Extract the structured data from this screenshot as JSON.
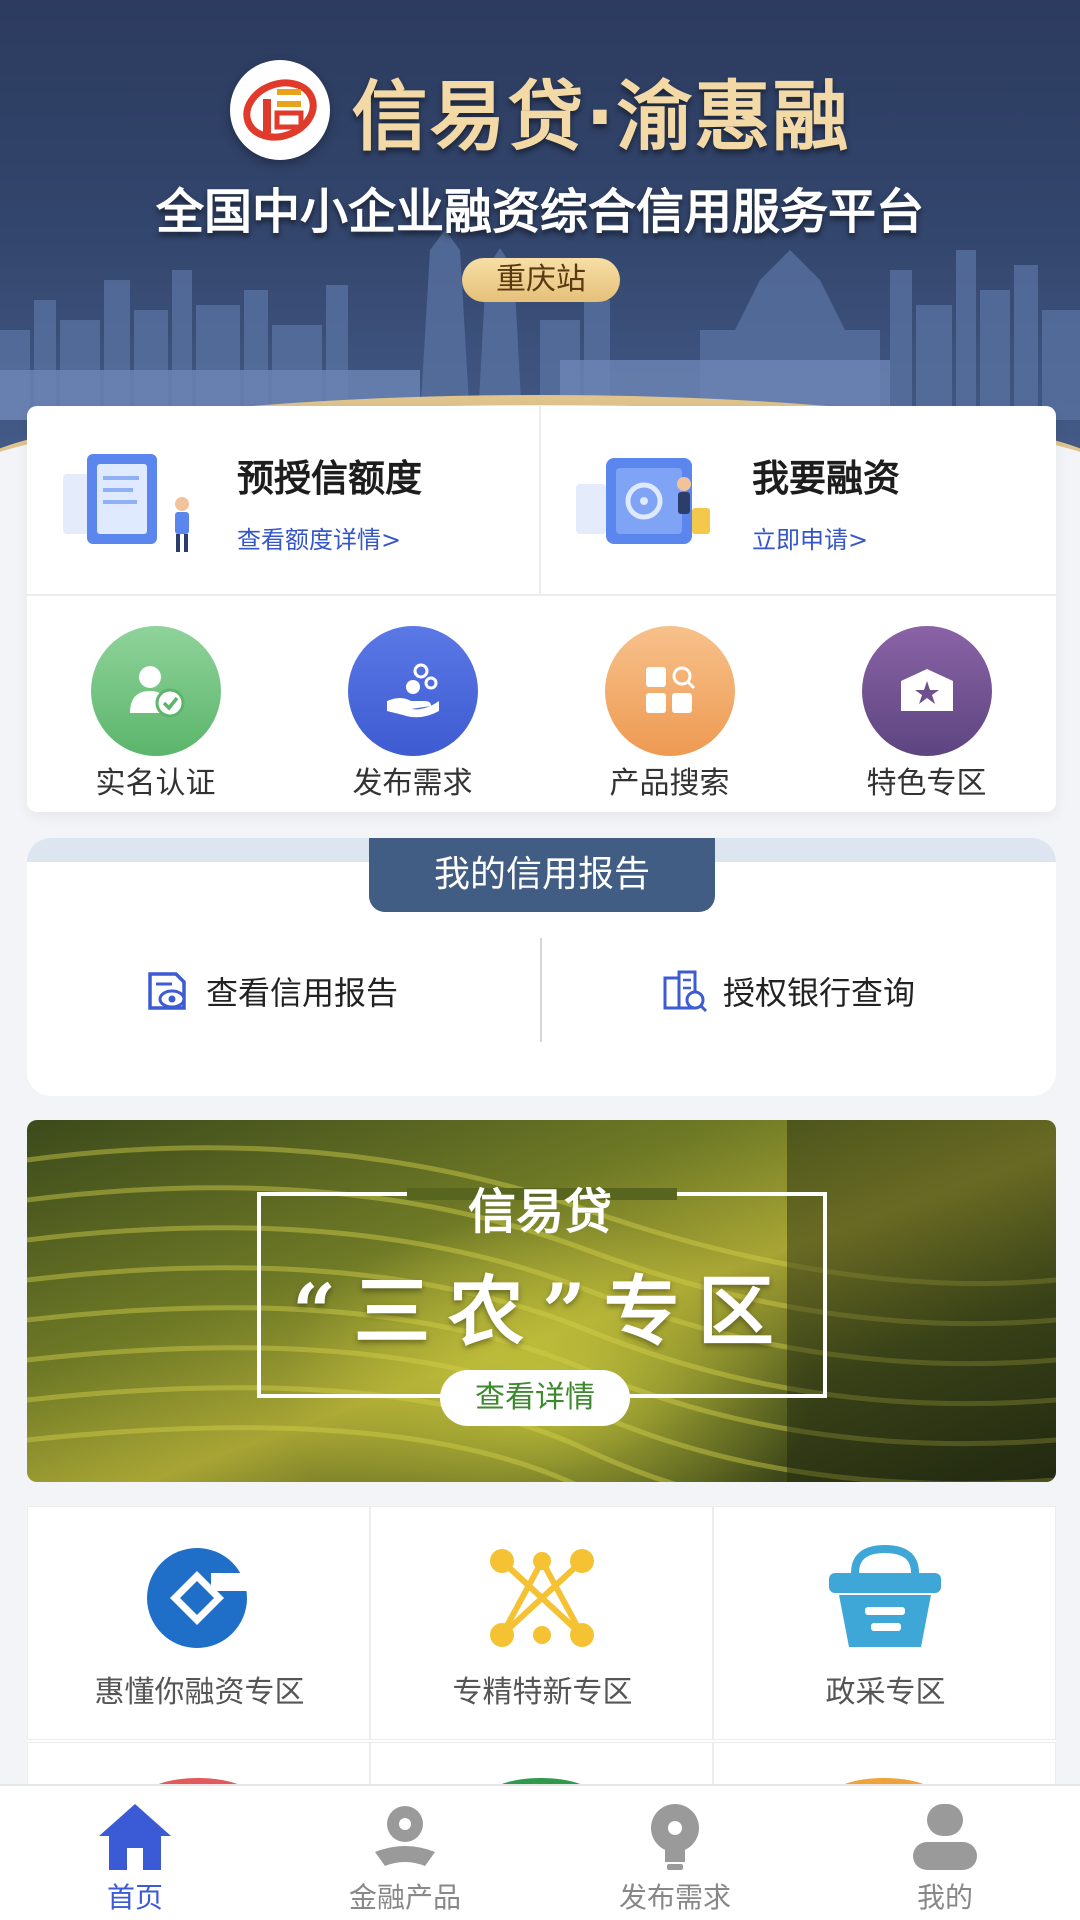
{
  "header": {
    "brand_title": "信易贷·渝惠融",
    "subtitle": "全国中小企业融资综合信用服务平台",
    "station": "重庆站"
  },
  "quick_actions": [
    {
      "title": "预授信额度",
      "link": "查看额度详情>"
    },
    {
      "title": "我要融资",
      "link": "立即申请>"
    }
  ],
  "shortcuts": [
    {
      "label": "实名认证",
      "icon": "verified-user-icon",
      "color": "#6cc07a"
    },
    {
      "label": "发布需求",
      "icon": "hand-bubbles-icon",
      "color": "#4b67dc"
    },
    {
      "label": "产品搜索",
      "icon": "grid-search-icon",
      "color": "#f0a45e"
    },
    {
      "label": "特色专区",
      "icon": "star-envelope-icon",
      "color": "#6f4f8c"
    }
  ],
  "credit_report": {
    "title": "我的信用报告",
    "view_report": "查看信用报告",
    "bank_query": "授权银行查询"
  },
  "promo": {
    "top_caption": "信易贷",
    "main_text": "“三农”专区",
    "button": "查看详情"
  },
  "zones": [
    {
      "label": "惠懂你融资专区",
      "icon": "ccb-logo-icon"
    },
    {
      "label": "专精特新专区",
      "icon": "network-nodes-icon"
    },
    {
      "label": "政采专区",
      "icon": "shopping-basket-icon"
    }
  ],
  "tabbar": [
    {
      "label": "首页",
      "icon": "home-icon",
      "active": true
    },
    {
      "label": "金融产品",
      "icon": "finance-product-icon",
      "active": false
    },
    {
      "label": "发布需求",
      "icon": "lightbulb-icon",
      "active": false
    },
    {
      "label": "我的",
      "icon": "user-icon",
      "active": false
    }
  ],
  "colors": {
    "accent": "#3b5bd6",
    "banner": "#33466d",
    "credit_tab": "#415d84",
    "gold": "#f3d9a6"
  }
}
